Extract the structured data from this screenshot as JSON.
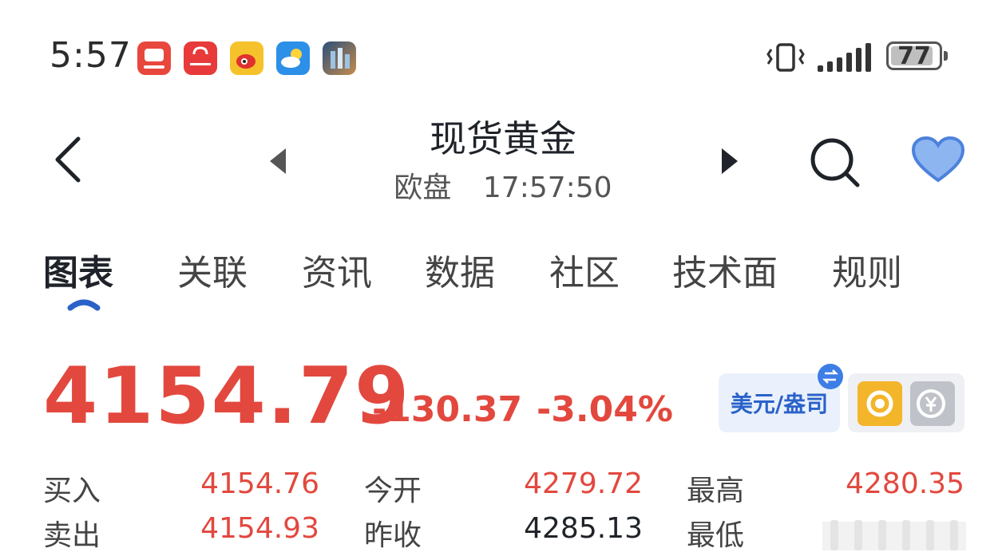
{
  "status_bar": {
    "time": "5:57",
    "battery": "77",
    "app_icons": [
      "vipshop-app-icon",
      "huawei-appgallery-icon",
      "weibo-icon",
      "weather-icon",
      "gallery-icon"
    ]
  },
  "header": {
    "title": "现货黄金",
    "session": "欧盘",
    "clock": "17:57:50"
  },
  "tabs": [
    {
      "label": "图表",
      "active": true
    },
    {
      "label": "关联"
    },
    {
      "label": "资讯"
    },
    {
      "label": "数据"
    },
    {
      "label": "社区"
    },
    {
      "label": "技术面"
    },
    {
      "label": "规则"
    }
  ],
  "quote": {
    "price": "4154.79",
    "change": "-130.37",
    "change_pct": "-3.04%",
    "currency_unit": "美元/盎司"
  },
  "stats": {
    "buy_label": "买入",
    "buy_value": "4154.76",
    "sell_label": "卖出",
    "sell_value": "4154.93",
    "open_label": "今开",
    "open_value": "4279.72",
    "prev_close_label": "昨收",
    "prev_close_value": "4285.13",
    "high_label": "最高",
    "high_value": "4280.35",
    "low_label": "最低"
  },
  "colors": {
    "down": "#e2483e",
    "accent_blue": "#3d7de6",
    "favorite_heart": "#6fa0ea"
  }
}
